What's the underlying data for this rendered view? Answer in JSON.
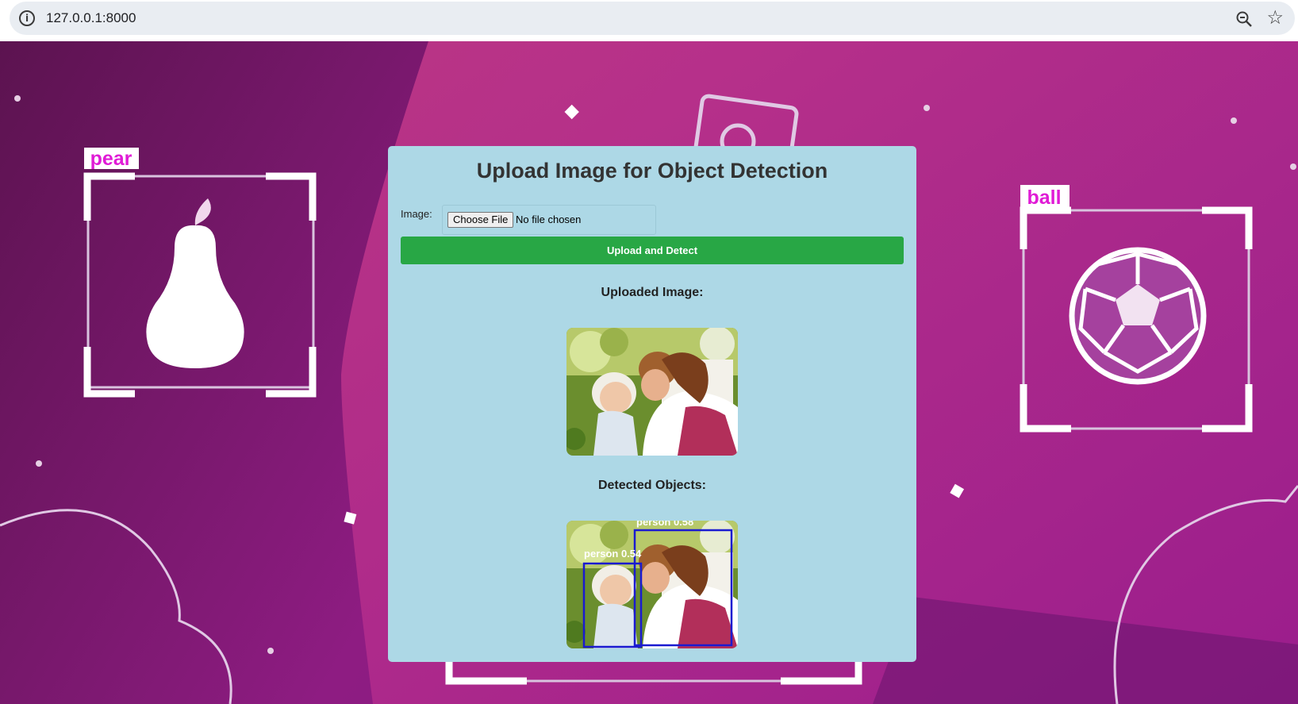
{
  "browser": {
    "url": "127.0.0.1:8000",
    "icons": [
      "info-icon",
      "zoom-icon",
      "star-icon"
    ]
  },
  "background": {
    "left_label": "pear",
    "right_label": "ball",
    "label_color": "#e01bd6"
  },
  "card": {
    "title": "Upload Image for Object Detection",
    "image_label": "Image:",
    "file_button": "Choose File",
    "file_status": "No file chosen",
    "upload_button": "Upload and Detect",
    "uploaded_heading": "Uploaded Image:",
    "detected_heading": "Detected Objects:",
    "detections": [
      {
        "label": "person 0.54",
        "color": "#1a1ad0"
      },
      {
        "label": "person 0.58",
        "color": "#1a1ad0"
      }
    ]
  },
  "colors": {
    "card_bg": "#add8e6",
    "button_bg": "#28a745",
    "box_color": "#1a1ad0"
  }
}
